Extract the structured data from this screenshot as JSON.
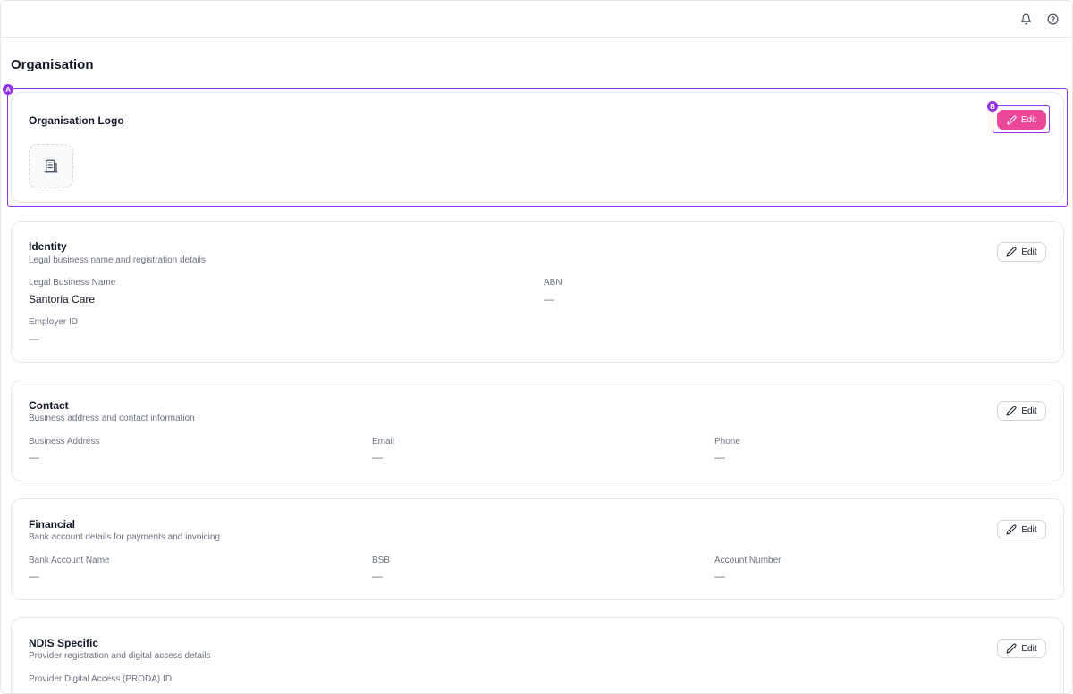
{
  "header": {
    "icons": [
      "bell-icon",
      "help-icon"
    ]
  },
  "page": {
    "title": "Organisation"
  },
  "annotations": {
    "a": "A",
    "b": "B"
  },
  "logo_card": {
    "title": "Organisation Logo",
    "edit_label": "Edit",
    "placeholder_icon": "building-icon"
  },
  "identity": {
    "title": "Identity",
    "subtitle": "Legal business name and registration details",
    "edit_label": "Edit",
    "fields": [
      {
        "label": "Legal Business Name",
        "value": "Santoria Care"
      },
      {
        "label": "ABN",
        "value": "—"
      },
      {
        "label": "Employer ID",
        "value": "—"
      }
    ]
  },
  "contact": {
    "title": "Contact",
    "subtitle": "Business address and contact information",
    "edit_label": "Edit",
    "fields": [
      {
        "label": "Business Address",
        "value": "—"
      },
      {
        "label": "Email",
        "value": "—"
      },
      {
        "label": "Phone",
        "value": "—"
      }
    ]
  },
  "financial": {
    "title": "Financial",
    "subtitle": "Bank account details for payments and invoicing",
    "edit_label": "Edit",
    "fields": [
      {
        "label": "Bank Account Name",
        "value": "—"
      },
      {
        "label": "BSB",
        "value": "—"
      },
      {
        "label": "Account Number",
        "value": "—"
      }
    ]
  },
  "ndis": {
    "title": "NDIS Specific",
    "subtitle": "Provider registration and digital access details",
    "edit_label": "Edit",
    "fields": [
      {
        "label": "Provider Digital Access (PRODA) ID",
        "value": "—"
      }
    ]
  },
  "colors": {
    "accent_pink": "#ec4899",
    "annotation_purple": "#9333ea"
  }
}
